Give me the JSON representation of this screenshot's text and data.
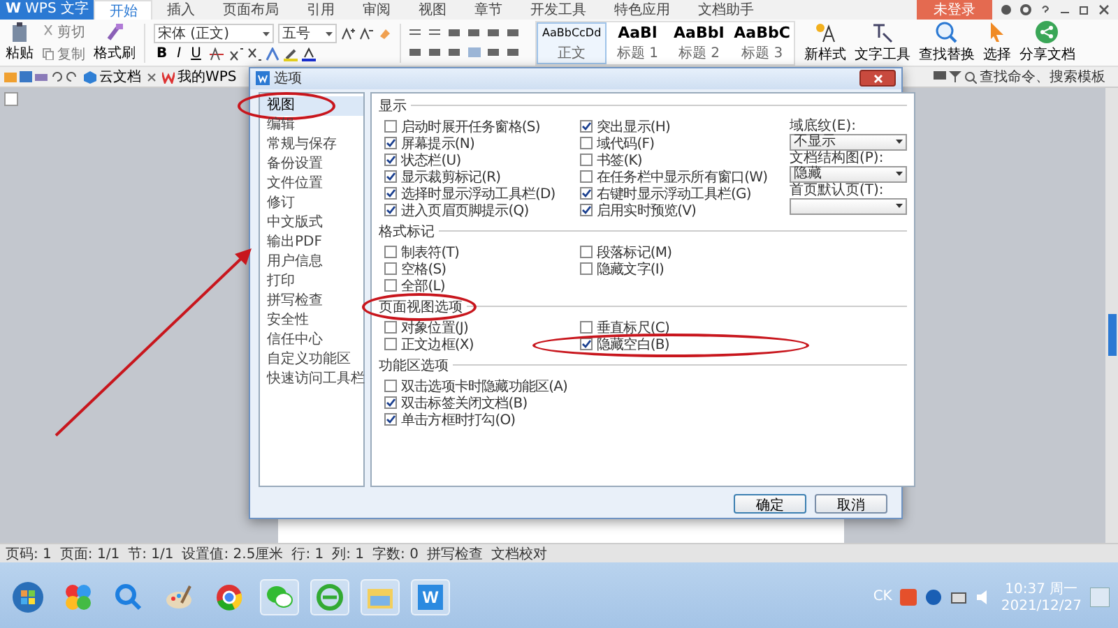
{
  "app": {
    "logo": "W",
    "title": "WPS 文字",
    "login": "未登录"
  },
  "tabs": [
    {
      "label": "开始",
      "selected": true
    },
    {
      "label": "插入",
      "selected": false
    },
    {
      "label": "页面布局",
      "selected": false
    },
    {
      "label": "引用",
      "selected": false
    },
    {
      "label": "审阅",
      "selected": false
    },
    {
      "label": "视图",
      "selected": false
    },
    {
      "label": "章节",
      "selected": false
    },
    {
      "label": "开发工具",
      "selected": false
    },
    {
      "label": "特色应用",
      "selected": false
    },
    {
      "label": "文档助手",
      "selected": false
    }
  ],
  "ribbon": {
    "paste": "粘贴",
    "cut": "剪切",
    "copy": "复制",
    "format_painter": "格式刷",
    "font": "宋体 (正文)",
    "size": "五号",
    "text_buttons": [
      "B",
      "I",
      "U"
    ],
    "styles": [
      {
        "preview": "AaBbCcDd",
        "label": "正文",
        "selected": true
      },
      {
        "preview": "AaBl",
        "label": "标题 1",
        "selected": false
      },
      {
        "preview": "AaBbI",
        "label": "标题 2",
        "selected": false
      },
      {
        "preview": "AaBbC",
        "label": "标题 3",
        "selected": false
      }
    ],
    "tools": [
      {
        "kind": "style",
        "label": "新样式"
      },
      {
        "kind": "text",
        "label": "文字工具"
      },
      {
        "kind": "find",
        "label": "查找替换"
      },
      {
        "kind": "select",
        "label": "选择"
      },
      {
        "kind": "share",
        "label": "分享文档"
      }
    ]
  },
  "doc_tabs": [
    {
      "label": "云文档"
    },
    {
      "label": "我的WPS"
    }
  ],
  "search": {
    "placeholder": "查找命令、搜索模板"
  },
  "dialog": {
    "title": "选项",
    "nav": [
      {
        "label": "视图",
        "selected": true
      },
      {
        "label": "编辑",
        "selected": false
      },
      {
        "label": "常规与保存",
        "selected": false
      },
      {
        "label": "备份设置",
        "selected": false
      },
      {
        "label": "文件位置",
        "selected": false
      },
      {
        "label": "修订",
        "selected": false
      },
      {
        "label": "中文版式",
        "selected": false
      },
      {
        "label": "输出PDF",
        "selected": false
      },
      {
        "label": "用户信息",
        "selected": false
      },
      {
        "label": "打印",
        "selected": false
      },
      {
        "label": "拼写检查",
        "selected": false
      },
      {
        "label": "安全性",
        "selected": false
      },
      {
        "label": "信任中心",
        "selected": false
      },
      {
        "label": "自定义功能区",
        "selected": false
      },
      {
        "label": "快速访问工具栏",
        "selected": false
      }
    ],
    "sections": [
      {
        "title": "显示",
        "columns": [
          {
            "items": [
              {
                "label": "启动时展开任务窗格(S)",
                "checked": false
              },
              {
                "label": "屏幕提示(N)",
                "checked": true
              },
              {
                "label": "状态栏(U)",
                "checked": true
              },
              {
                "label": "显示裁剪标记(R)",
                "checked": true
              },
              {
                "label": "选择时显示浮动工具栏(D)",
                "checked": true
              },
              {
                "label": "进入页眉页脚提示(Q)",
                "checked": true
              }
            ]
          },
          {
            "items": [
              {
                "label": "突出显示(H)",
                "checked": true
              },
              {
                "label": "域代码(F)",
                "checked": false
              },
              {
                "label": "书签(K)",
                "checked": false
              },
              {
                "label": "在任务栏中显示所有窗口(W)",
                "checked": false
              },
              {
                "label": "右键时显示浮动工具栏(G)",
                "checked": true
              },
              {
                "label": "启用实时预览(V)",
                "checked": true
              }
            ]
          }
        ],
        "fields": [
          {
            "label": "域底纹(E):",
            "value": "不显示"
          },
          {
            "label": "文档结构图(P):",
            "value": "隐藏"
          },
          {
            "label": "首页默认页(T):"
          }
        ]
      },
      {
        "title": "格式标记",
        "columns": [
          {
            "items": [
              {
                "label": "制表符(T)",
                "checked": false
              },
              {
                "label": "空格(S)",
                "checked": false
              },
              {
                "label": "全部(L)",
                "checked": false
              }
            ]
          },
          {
            "items": [
              {
                "label": "段落标记(M)",
                "checked": false
              },
              {
                "label": "隐藏文字(I)",
                "checked": false
              }
            ]
          }
        ]
      },
      {
        "title": "页面视图选项",
        "columns": [
          {
            "items": [
              {
                "label": "对象位置(J)",
                "checked": false
              },
              {
                "label": "正文边框(X)",
                "checked": false
              }
            ]
          },
          {
            "items": [
              {
                "label": "垂直标尺(C)",
                "checked": false
              },
              {
                "label": "隐藏空白(B)",
                "checked": true
              }
            ]
          }
        ]
      },
      {
        "title": "功能区选项",
        "columns": [
          {
            "items": [
              {
                "label": "双击选项卡时隐藏功能区(A)",
                "checked": false
              },
              {
                "label": "双击标签关闭文档(B)",
                "checked": true
              },
              {
                "label": "单击方框时打勾(O)",
                "checked": true
              }
            ]
          }
        ]
      }
    ],
    "buttons": [
      "确定",
      "取消"
    ]
  },
  "status_bar": [
    "页码: 1",
    "页面: 1/1",
    "节: 1/1",
    "设置值: 2.5厘米",
    "行: 1",
    "列: 1",
    "字数: 0",
    "拼写检查",
    "文档校对"
  ],
  "taskbar": {
    "app_label": "W",
    "tray_label": "CK",
    "time": "10:37 周一",
    "date": "2021/12/27"
  }
}
